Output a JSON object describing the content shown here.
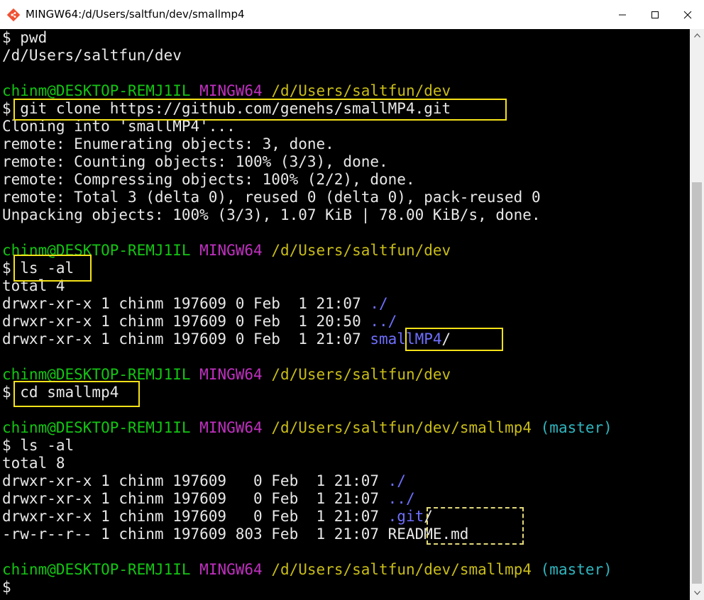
{
  "window": {
    "title": "MINGW64:/d/Users/saltfun/dev/smallmp4",
    "app_icon": "git-bash-icon",
    "controls": [
      "minimize-icon",
      "maximize-icon",
      "close-icon"
    ]
  },
  "terminal": {
    "colors": {
      "user_host": "#13c613",
      "env": "#c030c0",
      "path": "#c9bd17",
      "branch": "#2fb5bf",
      "dir": "#6f6fff",
      "text": "#e8e8e8",
      "highlight": "#f5e219"
    },
    "prompt": {
      "user_host": "chinm@DESKTOP-REMJ1IL",
      "env": "MINGW64",
      "path_dev": "/d/Users/saltfun/dev",
      "path_repo": "/d/Users/saltfun/dev/smallmp4",
      "branch": "(master)",
      "symbol": "$"
    },
    "lines": {
      "l1": "$ pwd",
      "l2": "/d/Users/saltfun/dev",
      "cmd_clone": "$ git clone https://github.com/genehs/smallMP4.git",
      "clone_1": "Cloning into 'smallMP4'...",
      "clone_2": "remote: Enumerating objects: 3, done.",
      "clone_3": "remote: Counting objects: 100% (3/3), done.",
      "clone_4": "remote: Compressing objects: 100% (2/2), done.",
      "clone_5": "remote: Total 3 (delta 0), reused 0 (delta 0), pack-reused 0",
      "clone_6": "Unpacking objects: 100% (3/3), 1.07 KiB | 78.00 KiB/s, done.",
      "cmd_ls1": "$ ls -al",
      "ls1_total": "total 4",
      "ls1_r1_meta": "drwxr-xr-x 1 chinm 197609 0 Feb  1 21:07 ",
      "ls1_r1_name": "./",
      "ls1_r2_meta": "drwxr-xr-x 1 chinm 197609 0 Feb  1 20:50 ",
      "ls1_r2_name": "../",
      "ls1_r3_meta": "drwxr-xr-x 1 chinm 197609 0 Feb  1 21:07 ",
      "ls1_r3_name": "smallMP4",
      "ls1_r3_slash": "/",
      "cmd_cd": "$ cd smallmp4",
      "cmd_ls2": "$ ls -al",
      "ls2_total": "total 8",
      "ls2_r1_meta": "drwxr-xr-x 1 chinm 197609   0 Feb  1 21:07 ",
      "ls2_r1_name": "./",
      "ls2_r2_meta": "drwxr-xr-x 1 chinm 197609   0 Feb  1 21:07 ",
      "ls2_r2_name": "../",
      "ls2_r3_meta": "drwxr-xr-x 1 chinm 197609   0 Feb  1 21:07 ",
      "ls2_r3_name": ".git",
      "ls2_r3_slash": "/",
      "ls2_r4_meta": "-rw-r--r-- 1 chinm 197609 803 Feb  1 21:07 ",
      "ls2_r4_name": "README.md",
      "final_prompt": "$"
    }
  },
  "scrollbar": {
    "up_icon": "arrow-up-icon",
    "down_icon": "arrow-down-icon"
  }
}
